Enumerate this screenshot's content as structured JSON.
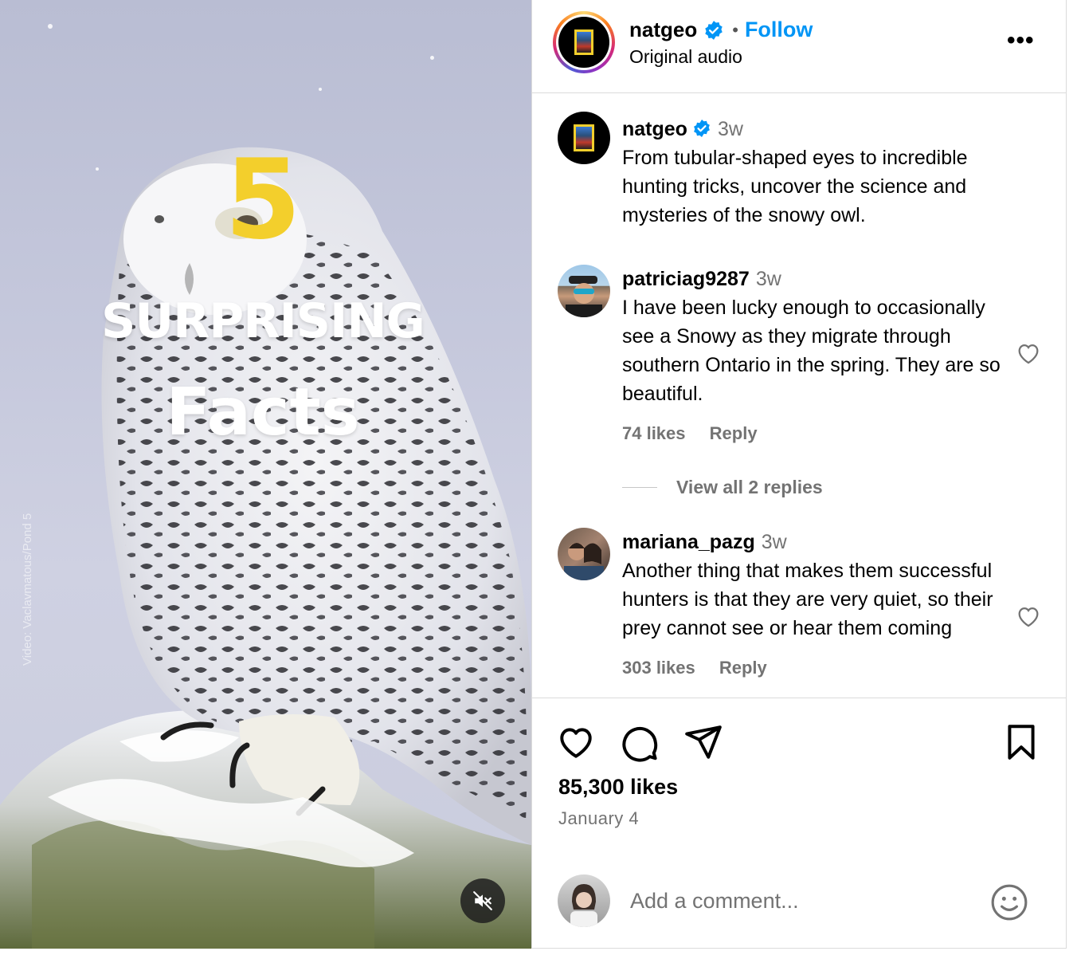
{
  "media": {
    "overlay_number": "5",
    "overlay_line1": "SURPRISING",
    "overlay_line2": "Facts",
    "credit": "Video: Vaclavmatous/Pond 5",
    "mute_icon": "speaker-muted-icon"
  },
  "header": {
    "username": "natgeo",
    "separator": "•",
    "follow_label": "Follow",
    "subtitle": "Original audio",
    "more_label": "•••"
  },
  "caption": {
    "username": "natgeo",
    "time": "3w",
    "text": "From tubular-shaped eyes to incredible hunting tricks, uncover the science and mysteries of the snowy owl."
  },
  "comments": [
    {
      "username": "patriciag9287",
      "time": "3w",
      "text": "I have been lucky enough to occasionally see a Snowy as they migrate through southern Ontario in the spring. They are so beautiful.",
      "likes": "74 likes",
      "reply_label": "Reply"
    },
    {
      "username": "mariana_pazg",
      "time": "3w",
      "text": "Another thing that makes them successful hunters is that they are very quiet, so their prey cannot see or hear them coming",
      "likes": "303 likes",
      "reply_label": "Reply"
    }
  ],
  "view_replies": "View all 2 replies",
  "post": {
    "likes": "85,300 likes",
    "date": "January 4"
  },
  "add_comment": {
    "placeholder": "Add a comment..."
  },
  "colors": {
    "accent": "#0095f6",
    "verified": "#0095f6",
    "overlay_yellow": "#f3cf2c",
    "muted_text": "#737373"
  }
}
